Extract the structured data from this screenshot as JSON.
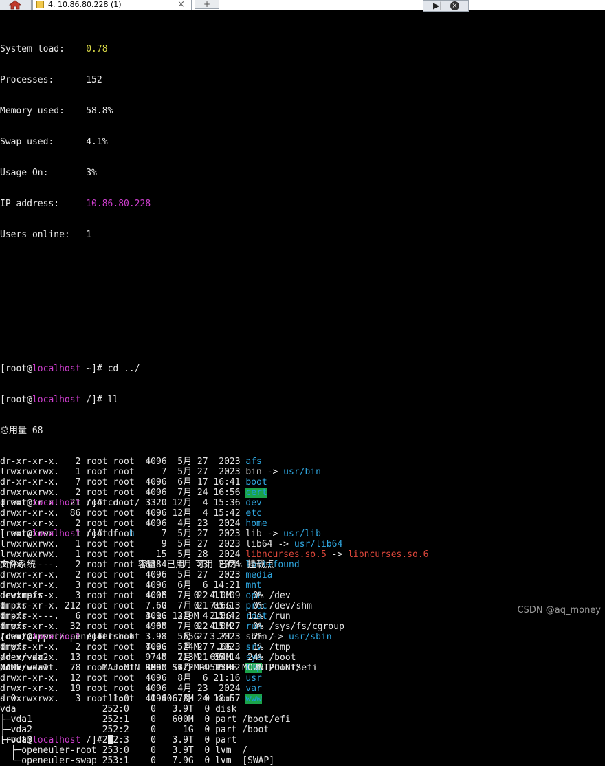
{
  "window": {
    "home_icon": "home-icon",
    "tab_icon": "terminal-icon",
    "tab_title": "4. 10.86.80.228 (1)",
    "tab_close": "×",
    "new_tab": "+",
    "ctrl_a": "▶|",
    "ctrl_b": "×"
  },
  "sysinfo": {
    "load_label": "System load:    ",
    "load_value": "0.78",
    "proc_label": "Processes:      ",
    "proc_value": "152",
    "mem_label": "Memory used:    ",
    "mem_value": "58.8%",
    "swap_label": "Swap used:      ",
    "swap_value": "4.1%",
    "usage_label": "Usage On:       ",
    "usage_value": "3%",
    "ip_label": "IP address:     ",
    "ip_value": "10.86.80.228",
    "users_label": "Users online:   ",
    "users_value": "1"
  },
  "prompt": {
    "open": "[root@",
    "host": "localhost",
    "home_dir": " ~]# ",
    "root_dir": " /]# "
  },
  "cmds": {
    "cd": "cd ../",
    "ll": "ll",
    "df": "df ",
    "df_flag": "-h",
    "lsblk": "lsblk"
  },
  "ll": {
    "total": "总用量 68",
    "entries": [
      {
        "meta": "dr-xr-xr-x.   2 root root  4096  5月 27  2023 ",
        "name": "afs"
      },
      {
        "meta": "lrwxrwxrwx.   1 root root     7  5月 27  2023 ",
        "name": "bin",
        "arrow": " -> ",
        "target": "usr/bin"
      },
      {
        "meta": "dr-xr-xr-x.   7 root root  4096  6月 17 16:41 ",
        "name": "boot"
      },
      {
        "meta": "drwxrwxrwx.   2 root root  4096  7月 24 16:56 ",
        "name": "cert"
      },
      {
        "meta": "drwxr-xr-x.  21 root root  3320 12月  4 15:36 ",
        "name": "dev"
      },
      {
        "meta": "drwxr-xr-x.  86 root root  4096 12月  4 15:42 ",
        "name": "etc"
      },
      {
        "meta": "drwxr-xr-x.   2 root root  4096  4月 23  2024 ",
        "name": "home"
      },
      {
        "meta": "lrwxrwxrwx.   1 root root     7  5月 27  2023 ",
        "name": "lib",
        "arrow": " -> ",
        "target": "usr/lib"
      },
      {
        "meta": "lrwxrwxrwx.   1 root root     9  5月 27  2023 ",
        "name": "lib64",
        "arrow": " -> ",
        "target": "usr/lib64"
      },
      {
        "meta": "lrwxrwxrwx.   1 root root    15  5月 28  2024 ",
        "name": "libncurses.so.5",
        "arrow": " -> ",
        "target": "libncurses.so.6"
      },
      {
        "meta": "drwx------.   2 root root 16384  4月 23  2024 ",
        "name": "lost+found"
      },
      {
        "meta": "drwxr-xr-x.   2 root root  4096  5月 27  2023 ",
        "name": "media"
      },
      {
        "meta": "drwxr-xr-x.   3 root root  4096  6月  6 14:21 ",
        "name": "mnt"
      },
      {
        "meta": "drwxr-xr-x.   3 root root  4096  7月 22 11:09 ",
        "name": "opt"
      },
      {
        "meta": "dr-xr-xr-x. 212 root root     0  7月 21 05:13 ",
        "name": "proc"
      },
      {
        "meta": "dr-xr-x---.   6 root root  4096 12月  4 15:42 ",
        "name": "root"
      },
      {
        "meta": "drwxr-xr-x.  32 root root   960  7月 22 15:27 ",
        "name": "run"
      },
      {
        "meta": "lrwxrwxrwx.   1 root root     8  5月 27  2023 ",
        "name": "sbin",
        "arrow": " -> ",
        "target": "usr/sbin"
      },
      {
        "meta": "drwxr-xr-x.   2 root root  4096  5月 27  2023 ",
        "name": "srv"
      },
      {
        "meta": "dr-xr-xr-x.  13 root root     0  7月 21 05:14 ",
        "name": "sys"
      },
      {
        "meta": "drwxrwxrwt.  78 root root  1860 12月  4 15:42 ",
        "name": "tmp"
      },
      {
        "meta": "drwxr-xr-x.  12 root root  4096  8月  6 21:16 ",
        "name": "usr"
      },
      {
        "meta": "drwxr-xr-x.  19 root root  4096  4月 23  2024 ",
        "name": "var"
      },
      {
        "meta": "drwxrwxrwx.   3 root root  4096  7月 24 18:57 ",
        "name": "www"
      }
    ]
  },
  "df": {
    "header": "文件系统                   容量  已用  可用 已用% 挂载点",
    "rows": [
      "devtmpfs                   4.0M     0  4.0M    0% /dev",
      "tmpfs                      7.6G     0  7.6G    0% /dev/shm",
      "tmpfs                      3.1G  310M  2.8G   11% /run",
      "tmpfs                      4.0M     0  4.0M    0% /sys/fs/cgroup",
      "/dev/mapper/openeuler-root 3.9T   65G  3.7T    2% /",
      "tmpfs                      7.6G   24M  7.6G    1% /tmp",
      "/dev/vda2                  974M  213M  694M   24% /boot",
      "/dev/vda1                  599M  6.2M  593M    2% /boot/efi"
    ]
  },
  "lsblk": {
    "header": "NAME               MAJ:MIN RM   SIZE RO TYPE MOUNTPOINTS",
    "rows": [
      "sr0                 11:0    1 406.8M  0 rom",
      "vda                252:0    0   3.9T  0 disk",
      "├─vda1             252:1    0   600M  0 part /boot/efi",
      "├─vda2             252:2    0     1G  0 part /boot",
      "└─vda3             252:3    0   3.9T  0 part",
      "  ├─openeuler-root 253:0    0   3.9T  0 lvm  /",
      "  └─openeuler-swap 253:1    0   7.9G  0 lvm  [SWAP]"
    ]
  },
  "watermark": "CSDN @aq_money",
  "colors": {
    "background": "#000000",
    "text": "#e8e8e8",
    "host": "#cf3fcf",
    "directory": "#2fa7e0",
    "load_value": "#d7d746",
    "broken_link": "#e0483c",
    "sticky_dir_bg": "#1aa34a"
  }
}
